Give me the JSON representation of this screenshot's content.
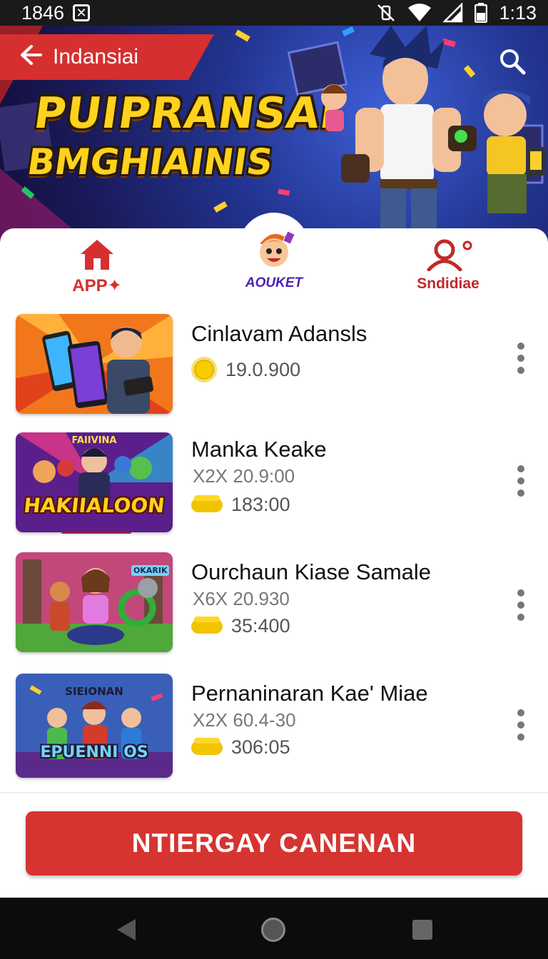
{
  "status_bar": {
    "left_number": "1846",
    "notification_glyph": "✕",
    "time": "1:13",
    "icons": [
      "vibrate-off-icon",
      "wifi-icon",
      "signal-icon",
      "battery-icon"
    ]
  },
  "header": {
    "back_label": "Indansiai",
    "title_line1": "PUIPRANSAI",
    "title_line2": "BMGHIAINIS"
  },
  "tabs": [
    {
      "label": "APP",
      "icon": "home-icon",
      "active": true
    },
    {
      "label": "AOUKET",
      "icon": "mascot-icon",
      "active": false
    },
    {
      "label": "Sndidiae",
      "icon": "user-icon",
      "active": false
    }
  ],
  "items": [
    {
      "title": "Cinlavam Adansls",
      "meta": "",
      "coins": "19.0.900",
      "coin_icon": "coin-round-icon"
    },
    {
      "title": "Manka Keake",
      "meta": "X2X 20.9:00",
      "coins": "183:00",
      "coin_icon": "coin-stack-icon"
    },
    {
      "title": "Ourchaun Kiase Samale",
      "meta": "X6X 20.930",
      "coins": "35:400",
      "coin_icon": "coin-stack-icon"
    },
    {
      "title": "Pernaninaran Kae' Miae",
      "meta": "X2X 60.4-30",
      "coins": "306:05",
      "coin_icon": "coin-stack-icon"
    }
  ],
  "thumbnails": {
    "item2_text": "HAKIIALOON",
    "item2_subtext": "FAIIVINA",
    "item3_text": "OKARIK",
    "item4_text": "EPUENNI OS",
    "item4_subtext": "SIEIONAN"
  },
  "cta": {
    "label": "NTIERGAY CANENAN"
  },
  "colors": {
    "accent": "#d62f2f",
    "tab_purple": "#4b1fb5",
    "coin_yellow": "#f8cd00"
  },
  "nav": {
    "icons": [
      "nav-back-icon",
      "nav-home-icon",
      "nav-recent-icon"
    ]
  }
}
